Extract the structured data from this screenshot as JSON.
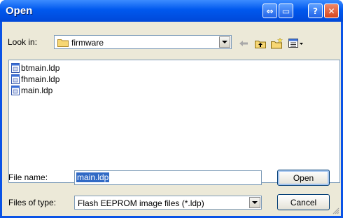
{
  "window": {
    "title": "Open",
    "restore_symbol": "⇔",
    "minimize_symbol": "▭",
    "help_symbol": "?",
    "close_symbol": "✕"
  },
  "lookin": {
    "label": "Look in:",
    "folder": "firmware"
  },
  "toolbar": {
    "back_icon": "back-arrow-icon",
    "up_icon": "up-folder-icon",
    "new_folder_icon": "new-folder-icon",
    "views_icon": "views-menu-icon"
  },
  "files": [
    {
      "name": "btmain.ldp"
    },
    {
      "name": "fhmain.ldp"
    },
    {
      "name": "main.ldp"
    }
  ],
  "filename": {
    "label": "File name:",
    "value": "main.ldp"
  },
  "filetype": {
    "label": "Files of type:",
    "value": "Flash EEPROM image files (*.ldp)"
  },
  "buttons": {
    "open": "Open",
    "cancel": "Cancel"
  },
  "colors": {
    "titlebar": "#0058ee",
    "dialog_face": "#ece9d8",
    "selection": "#316ac5",
    "close_button": "#d6461e"
  }
}
